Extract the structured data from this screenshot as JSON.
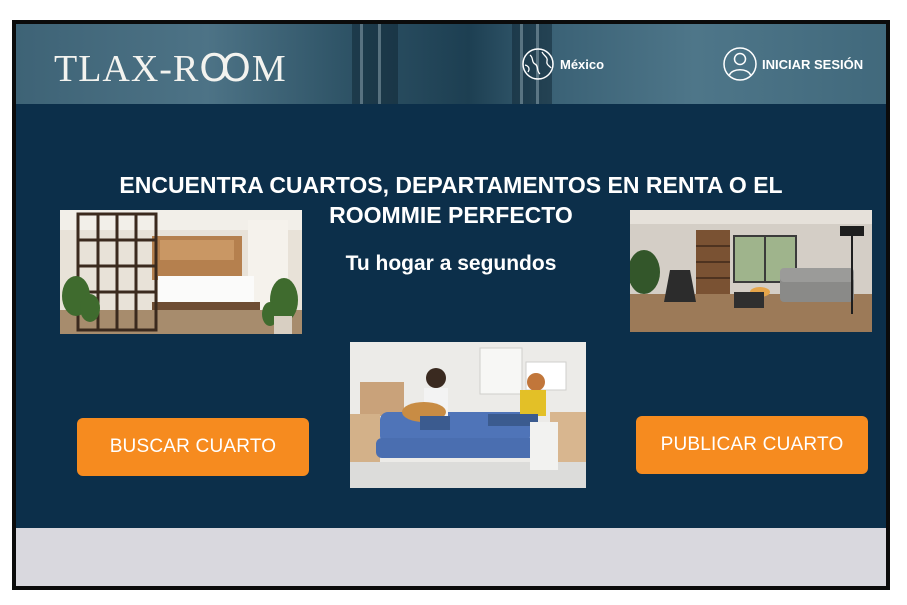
{
  "header": {
    "logo_text": "TLAX-RꝎM",
    "region_label": "México",
    "login_label": "INICIAR SESIÓN"
  },
  "hero": {
    "headline": "ENCUENTRA  CUARTOS, DEPARTAMENTOS EN RENTA O EL ROOMMIE PERFECTO",
    "tagline": "Tu hogar a segundos"
  },
  "actions": {
    "search_room": "BUSCAR CUARTO",
    "publish_room": "PUBLICAR CUARTO"
  },
  "icons": {
    "region": "globe-icon",
    "login": "user-circle-icon"
  },
  "colors": {
    "background": "#0c2f4a",
    "accent": "#f68b1f",
    "footer": "#d9d8de"
  }
}
